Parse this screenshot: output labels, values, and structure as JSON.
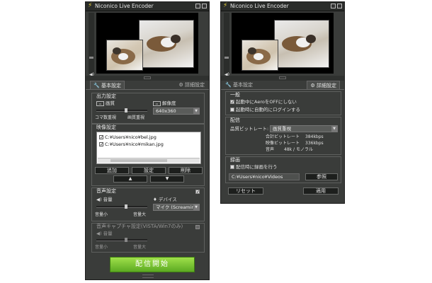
{
  "window_title": "Niconico Live Encoder",
  "tabs": {
    "basic": "基本設定",
    "detail": "詳細設定"
  },
  "left": {
    "output": {
      "title": "出力設定",
      "quality_label": "画質",
      "resolution_label": "解像度",
      "resolution_value": "640x360",
      "frame_priority": "コマ数重視",
      "quality_priority": "画質重視"
    },
    "video": {
      "title": "映像設定",
      "items": [
        "C:¥Users¥nico¥bel.jpg",
        "C:¥Users¥nico¥mikan.jpg"
      ],
      "buttons": {
        "add": "追加",
        "settings": "設定",
        "delete": "削除",
        "up": "▲",
        "down": "▼"
      }
    },
    "audio": {
      "title": "音声設定",
      "volume_label": "音量",
      "device_label": "デバイス",
      "device_value": "マイク (Screaming",
      "vol_low": "音量小",
      "vol_high": "音量大"
    },
    "capture": {
      "title": "音声キャプチャ設定(VISTA/Win7のみ)",
      "volume_label": "音量",
      "vol_low": "音量小",
      "vol_high": "音量大"
    },
    "start_button": "配信開始"
  },
  "right": {
    "general": {
      "title": "一般",
      "aero_off": "起動中にAeroをOFFにしない",
      "auto_login": "起動時に自動的にログインする"
    },
    "broadcast": {
      "title": "配信",
      "quality_bitrate_label": "品質ビットレート:",
      "quality_value": "画質重視",
      "total_label": "合計ビットレート",
      "total_value": "384kbps",
      "video_label": "映像ビットレート",
      "video_value": "336kbps",
      "audio_label": "音声",
      "audio_value": "48k / モノラル"
    },
    "recording": {
      "title": "録画",
      "record_during": "配信時に録画を行う",
      "path": "C:¥Users¥nico¥Videos",
      "browse": "参照"
    },
    "reset": "リセット",
    "apply": "適用"
  }
}
